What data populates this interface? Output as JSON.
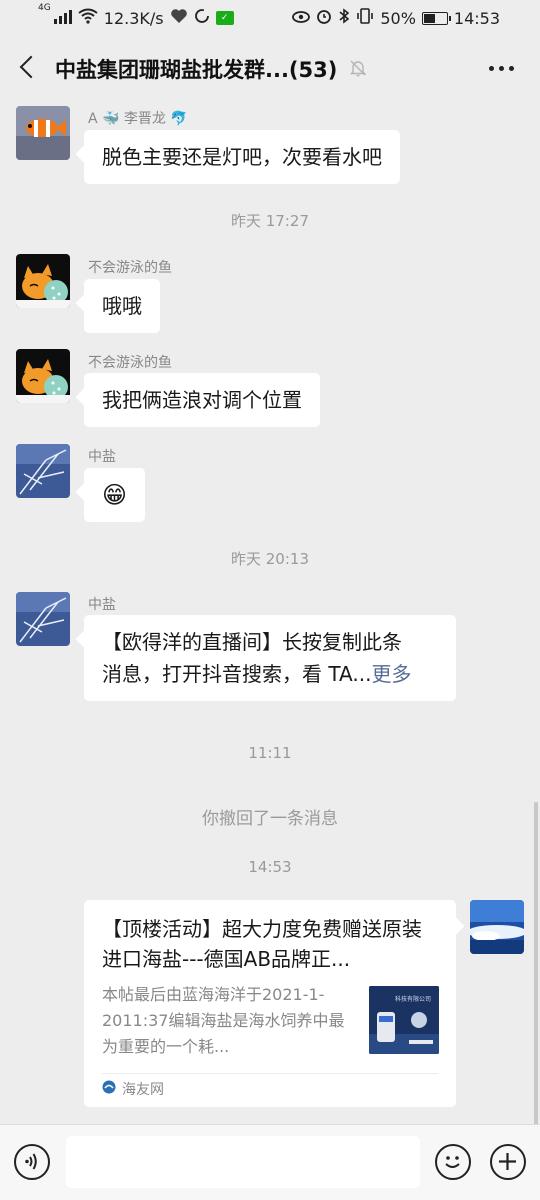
{
  "status_bar": {
    "network": "4G",
    "speed": "12.3K/s",
    "battery": "50%",
    "battery_level": 0.5,
    "time": "14:53"
  },
  "nav": {
    "title": "中盐集团珊瑚盐批发群...(53)",
    "icons": [
      "back-arrow-icon",
      "bell-off-icon",
      "more-dots-icon"
    ]
  },
  "messages": [
    {
      "sender": "A 🐳 李晋龙 🐬",
      "text": "脱色主要还是灯吧，次要看水吧"
    },
    {
      "time": "昨天 17:27"
    },
    {
      "sender": "不会游泳的鱼",
      "text": "哦哦"
    },
    {
      "sender": "不会游泳的鱼",
      "text": "我把俩造浪对调个位置"
    },
    {
      "sender": "中盐",
      "text": "😁"
    },
    {
      "time": "昨天 20:13"
    },
    {
      "sender": "中盐",
      "text_line1": "【欧得洋的直播间】长按复制此条",
      "text_line2": "消息，打开抖音搜索，看 TA...",
      "more": "更多"
    },
    {
      "time": "11:11"
    },
    {
      "recall": "你撤回了一条消息"
    },
    {
      "time": "14:53"
    }
  ],
  "shared_card": {
    "title": "【顶楼活动】超大力度免费赠送原装进口海盐---德国AB品牌正...",
    "description": "本帖最后由蓝海海洋于2021-1-2011:37编辑海盐是海水饲养中最为重要的一个耗...",
    "source": "海友网",
    "thumb_caption": "科技有限公司"
  },
  "input_bar": {
    "icons": [
      "voice-icon",
      "emoji-icon",
      "plus-icon"
    ]
  },
  "colors": {
    "background": "#ededed",
    "bubble": "#ffffff",
    "link": "#576b95",
    "meta_text": "#9a9a9a"
  }
}
